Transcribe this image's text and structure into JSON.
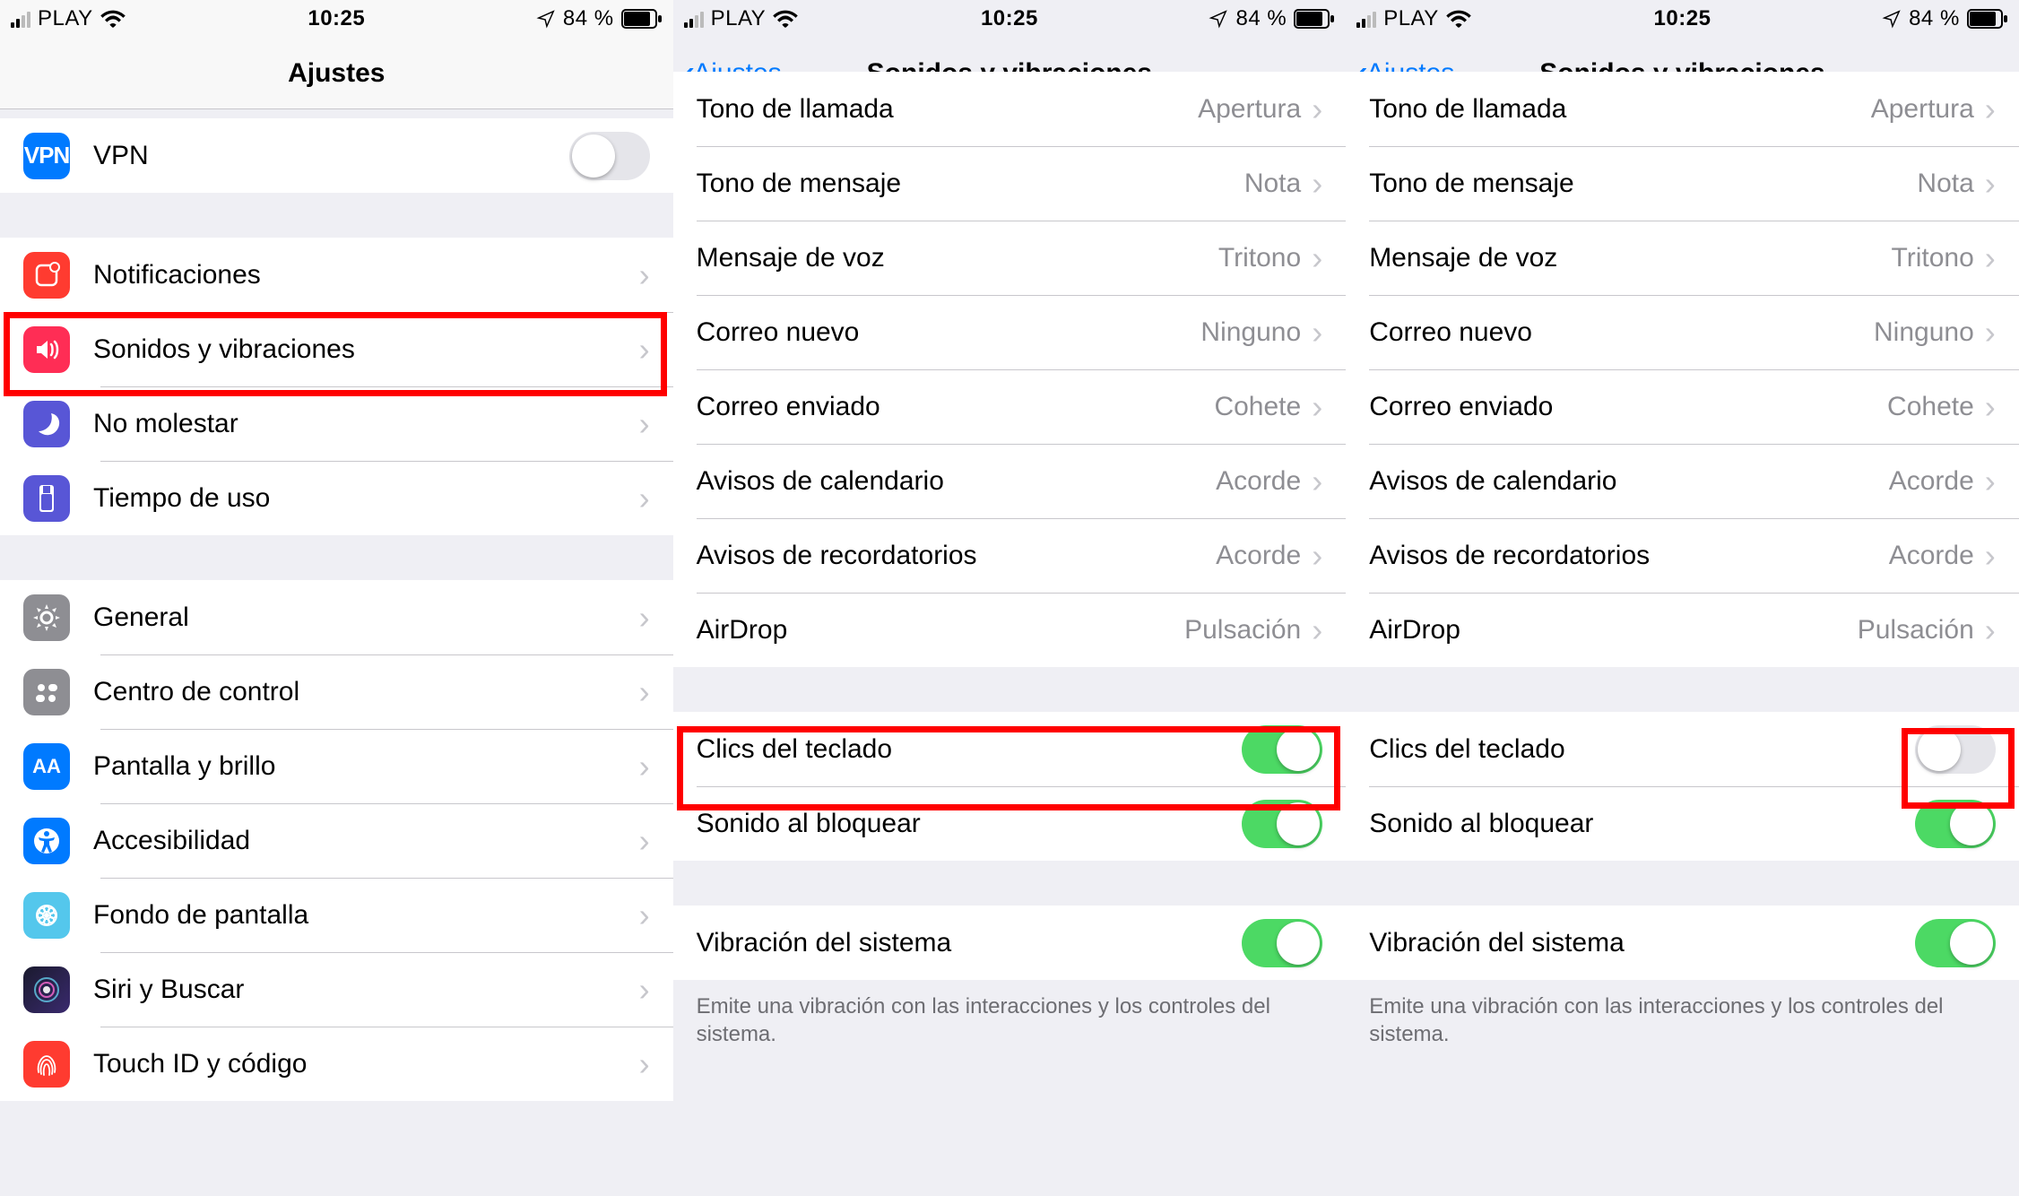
{
  "status": {
    "carrier": "PLAY",
    "time": "10:25",
    "battery_text": "84 %"
  },
  "screen1": {
    "title": "Ajustes",
    "vpn": "VPN",
    "vpn_on": false,
    "items_g1": [
      {
        "label": "Notificaciones",
        "icon": "notif"
      },
      {
        "label": "Sonidos y vibraciones",
        "icon": "sound",
        "highlight": true
      },
      {
        "label": "No molestar",
        "icon": "dnd"
      },
      {
        "label": "Tiempo de uso",
        "icon": "screen"
      }
    ],
    "items_g2": [
      {
        "label": "General",
        "icon": "general"
      },
      {
        "label": "Centro de control",
        "icon": "control"
      },
      {
        "label": "Pantalla y brillo",
        "icon": "display"
      },
      {
        "label": "Accesibilidad",
        "icon": "access"
      },
      {
        "label": "Fondo de pantalla",
        "icon": "wall"
      },
      {
        "label": "Siri y Buscar",
        "icon": "siri"
      },
      {
        "label": "Touch ID y código",
        "icon": "touch"
      }
    ]
  },
  "sounds": {
    "back": "Ajustes",
    "title": "Sonidos y vibraciones",
    "tones": [
      {
        "label": "Tono de llamada",
        "value": "Apertura"
      },
      {
        "label": "Tono de mensaje",
        "value": "Nota"
      },
      {
        "label": "Mensaje de voz",
        "value": "Tritono"
      },
      {
        "label": "Correo nuevo",
        "value": "Ninguno"
      },
      {
        "label": "Correo enviado",
        "value": "Cohete"
      },
      {
        "label": "Avisos de calendario",
        "value": "Acorde"
      },
      {
        "label": "Avisos de recordatorios",
        "value": "Acorde"
      },
      {
        "label": "AirDrop",
        "value": "Pulsación"
      }
    ],
    "keys_label": "Clics del teclado",
    "lock_label": "Sonido al bloquear",
    "haptic_label": "Vibración del sistema",
    "footer": "Emite una vibración con las interacciones y los controles del sistema."
  },
  "screen2": {
    "keys_on": true,
    "lock_on": true,
    "haptic_on": true
  },
  "screen3": {
    "keys_on": false,
    "lock_on": true,
    "haptic_on": true
  }
}
